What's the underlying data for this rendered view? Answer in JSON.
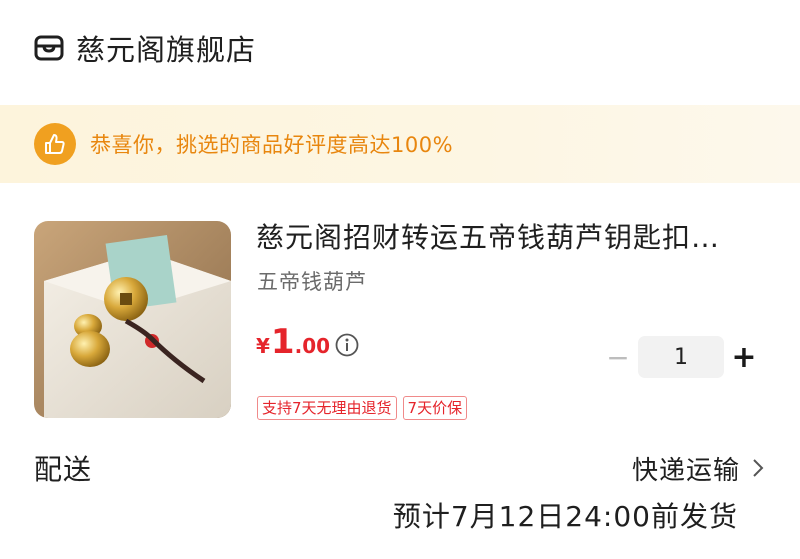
{
  "store": {
    "name": "慈元阁旗舰店",
    "icon": "store-icon"
  },
  "banner": {
    "text": "恭喜你，挑选的商品好评度高达100%",
    "icon": "thumbs-up-icon",
    "accent": "#f0a020"
  },
  "product": {
    "title": "慈元阁招财转运五帝钱葫芦钥匙扣…",
    "sku": "五帝钱葫芦",
    "price": {
      "currency": "¥",
      "integer": "1",
      "decimal": ".00"
    },
    "quantity": "1",
    "tags": [
      "支持7天无理由退货",
      "7天价保"
    ]
  },
  "stepper": {
    "minus": "−",
    "plus": "+"
  },
  "delivery": {
    "label": "配送",
    "method": "快递运输",
    "eta": "预计7月12日24:00前发货"
  },
  "colors": {
    "price_red": "#e5242b",
    "banner_text": "#e8860e"
  }
}
